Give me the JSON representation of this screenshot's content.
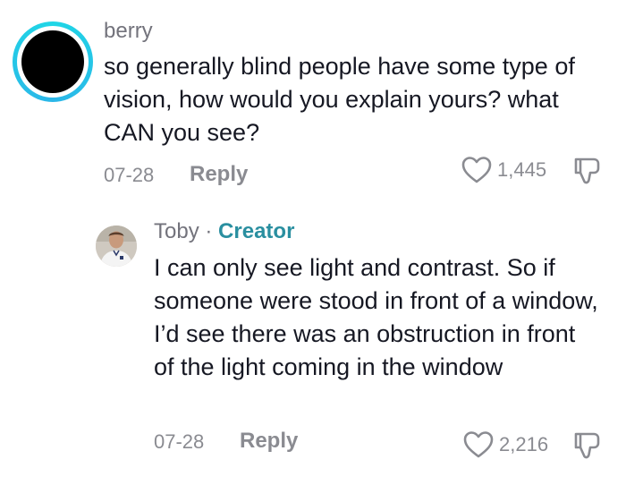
{
  "comment": {
    "username": "berry",
    "text": "so generally blind people have some type of vision, how would you explain yours? what CAN you see?",
    "date": "07-28",
    "reply_label": "Reply",
    "likes": "1,445"
  },
  "reply": {
    "username": "Toby",
    "separator": "·",
    "badge": "Creator",
    "text": "I can only see light and contrast. So if someone were stood in front of a window, I’d see there was an obstruction in front of the light coming in the window",
    "date": "07-28",
    "reply_label": "Reply",
    "likes": "2,216"
  },
  "colors": {
    "avatar_ring": "#1fd6e6",
    "creator_badge": "#2a8fa0",
    "muted_text": "#8a8b91"
  },
  "icons": {
    "like": "heart-outline-icon",
    "dislike": "thumbs-down-outline-icon"
  }
}
